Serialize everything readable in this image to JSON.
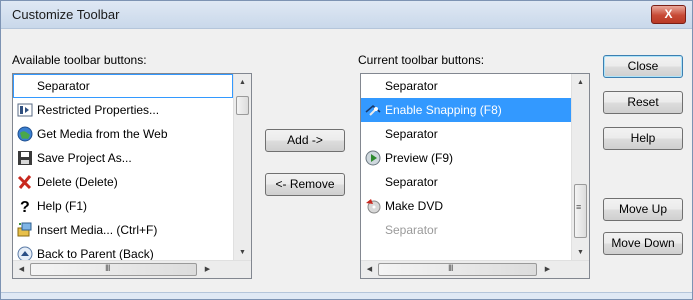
{
  "window": {
    "title": "Customize Toolbar",
    "close_glyph": "X"
  },
  "available": {
    "label": "Available toolbar buttons:",
    "items": [
      {
        "label": "Separator",
        "icon": ""
      },
      {
        "label": "Restricted Properties...",
        "icon": "restricted-properties-icon"
      },
      {
        "label": "Get Media from the Web",
        "icon": "globe-icon"
      },
      {
        "label": "Save Project As...",
        "icon": "save-as-icon"
      },
      {
        "label": "Delete (Delete)",
        "icon": "delete-x-icon"
      },
      {
        "label": "Help (F1)",
        "icon": "help-question-icon"
      },
      {
        "label": "Insert Media... (Ctrl+F)",
        "icon": "insert-media-icon"
      },
      {
        "label": "Back to Parent (Back)",
        "icon": "back-to-parent-icon"
      }
    ],
    "focused_index": 0
  },
  "current": {
    "label": "Current toolbar buttons:",
    "items": [
      {
        "label": "Separator",
        "icon": ""
      },
      {
        "label": "Enable Snapping (F8)",
        "icon": "snapping-icon"
      },
      {
        "label": "Separator",
        "icon": ""
      },
      {
        "label": "Preview (F9)",
        "icon": "preview-icon"
      },
      {
        "label": "Separator",
        "icon": ""
      },
      {
        "label": "Make DVD",
        "icon": "make-dvd-icon"
      },
      {
        "label": "Separator",
        "icon": ""
      }
    ],
    "selected_index": 1
  },
  "buttons": {
    "add": "Add ->",
    "remove": "<- Remove",
    "close": "Close",
    "reset": "Reset",
    "help": "Help",
    "move_up": "Move Up",
    "move_down": "Move Down"
  },
  "scroll": {
    "up": "▲",
    "down": "▼",
    "left": "◀",
    "right": "▶",
    "grip_h": "III",
    "grip_v": "≡"
  }
}
